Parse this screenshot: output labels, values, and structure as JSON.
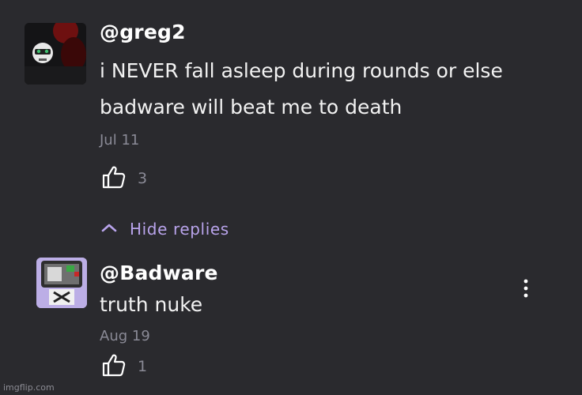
{
  "comments": [
    {
      "username": "@greg2",
      "text_lines": [
        "i NEVER fall asleep during rounds or else",
        "badware will beat me to death"
      ],
      "date": "Jul 11",
      "likes": "3"
    }
  ],
  "thread": {
    "hide_replies_label": "Hide replies"
  },
  "replies": [
    {
      "username": "@Badware",
      "text_lines": [
        "truth nuke"
      ],
      "date": "Aug 19",
      "likes": "1"
    }
  ],
  "watermark": "imgflip.com",
  "colors": {
    "background": "#2a2a2e",
    "accent": "#b9a4ec",
    "meta": "#8a8a96"
  },
  "icons": [
    "greg2-avatar",
    "badware-avatar",
    "thumbs-up-icon",
    "chevron-up-icon",
    "more-vert-icon"
  ]
}
